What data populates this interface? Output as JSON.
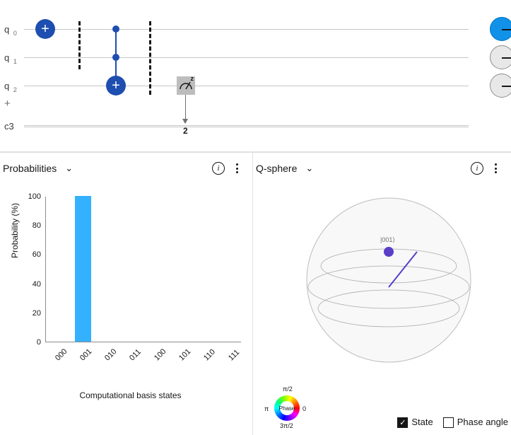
{
  "circuit": {
    "q_label": "q",
    "qubits": [
      "0",
      "1",
      "2"
    ],
    "add_symbol": "+",
    "cbit_label": "c3",
    "measure_target": "2",
    "measure_sup": "z"
  },
  "prob_panel": {
    "title": "Probabilities",
    "ylabel": "Probability (%)",
    "xlabel": "Computational basis states"
  },
  "qsphere_panel": {
    "title": "Q-sphere",
    "state_label": "|001⟩",
    "phase_center": "Phase",
    "ticks": {
      "top": "π/2",
      "left": "π",
      "right": "0",
      "bottom": "3π/2"
    },
    "legend_state": "State",
    "legend_phase": "Phase angle"
  },
  "chart_data": {
    "type": "bar",
    "title": "Probabilities",
    "xlabel": "Computational basis states",
    "ylabel": "Probability (%)",
    "ylim": [
      0,
      100
    ],
    "yticks": [
      0,
      20,
      40,
      60,
      80,
      100
    ],
    "categories": [
      "000",
      "001",
      "010",
      "011",
      "100",
      "101",
      "110",
      "111"
    ],
    "values": [
      0,
      100,
      0,
      0,
      0,
      0,
      0,
      0
    ]
  }
}
